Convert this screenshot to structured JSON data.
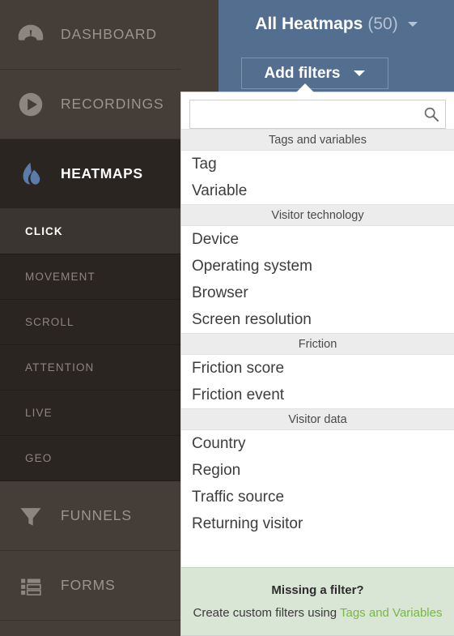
{
  "sidebar": {
    "main_items": [
      {
        "label": "DASHBOARD",
        "icon": "gauge-icon",
        "active": false
      },
      {
        "label": "RECORDINGS",
        "icon": "play-circle-icon",
        "active": false
      },
      {
        "label": "HEATMAPS",
        "icon": "flame-icon",
        "active": true
      },
      {
        "label": "FUNNELS",
        "icon": "funnel-icon",
        "active": false
      },
      {
        "label": "FORMS",
        "icon": "forms-icon",
        "active": false
      }
    ],
    "heatmap_subitems": [
      {
        "label": "CLICK",
        "active": true
      },
      {
        "label": "MOVEMENT",
        "active": false
      },
      {
        "label": "SCROLL",
        "active": false
      },
      {
        "label": "ATTENTION",
        "active": false
      },
      {
        "label": "LIVE",
        "active": false
      },
      {
        "label": "GEO",
        "active": false
      }
    ]
  },
  "header": {
    "title": "All Heatmaps",
    "count": "(50)",
    "add_filters_label": "Add filters",
    "background_color": "#546e90"
  },
  "dropdown": {
    "search": {
      "value": "",
      "placeholder": "",
      "icon": "search-icon"
    },
    "groups": [
      {
        "title": "Tags and variables",
        "options": [
          "Tag",
          "Variable"
        ]
      },
      {
        "title": "Visitor technology",
        "options": [
          "Device",
          "Operating system",
          "Browser",
          "Screen resolution"
        ]
      },
      {
        "title": "Friction",
        "options": [
          "Friction score",
          "Friction event"
        ]
      },
      {
        "title": "Visitor data",
        "options": [
          "Country",
          "Region",
          "Traffic source",
          "Returning visitor"
        ]
      }
    ],
    "footer": {
      "title": "Missing a filter?",
      "text": "Create custom filters using",
      "link_label": "Tags and Variables",
      "link_color": "#7ab648",
      "background_color": "#d9e5d5"
    }
  }
}
